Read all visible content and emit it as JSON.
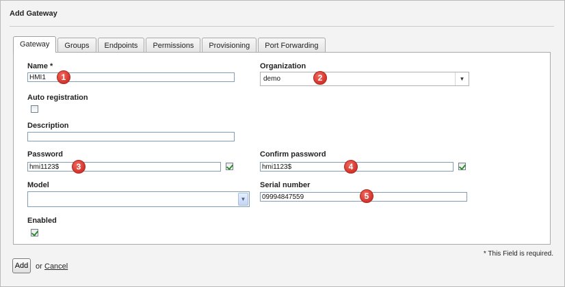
{
  "page": {
    "title": "Add Gateway"
  },
  "tabs": [
    {
      "label": "Gateway",
      "active": true
    },
    {
      "label": "Groups"
    },
    {
      "label": "Endpoints"
    },
    {
      "label": "Permissions"
    },
    {
      "label": "Provisioning"
    },
    {
      "label": "Port Forwarding"
    }
  ],
  "form": {
    "name": {
      "label": "Name *",
      "value": "HMI1"
    },
    "organization": {
      "label": "Organization",
      "value": "demo"
    },
    "auto_registration": {
      "label": "Auto registration",
      "checked": false
    },
    "description": {
      "label": "Description",
      "value": ""
    },
    "password": {
      "label": "Password",
      "value": "hmi1123$",
      "valid": true
    },
    "confirm_password": {
      "label": "Confirm password",
      "value": "hmi1123$",
      "valid": true
    },
    "model": {
      "label": "Model",
      "value": ""
    },
    "serial_number": {
      "label": "Serial number",
      "value": "09994847559"
    },
    "enabled": {
      "label": "Enabled",
      "checked": true
    }
  },
  "callouts": [
    "1",
    "2",
    "3",
    "4",
    "5"
  ],
  "footer": {
    "required_note": "* This Field is required.",
    "add_label": "Add",
    "or_text": "or",
    "cancel_label": "Cancel"
  },
  "icons": {
    "select_arrow": "triangle-down-icon",
    "model_arrow": "chevron-down-icon"
  },
  "colors": {
    "callout": "#d2332a",
    "check": "#2a8a2a",
    "input_border": "#7f9db9"
  }
}
